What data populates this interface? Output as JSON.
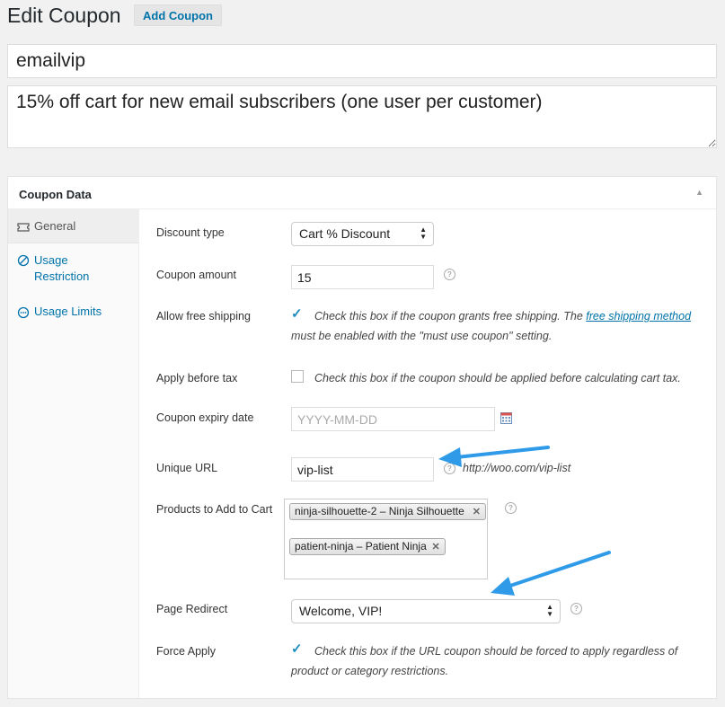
{
  "header": {
    "title": "Edit Coupon",
    "add_button": "Add Coupon"
  },
  "coupon": {
    "code": "emailvip",
    "description": "15% off cart for new email subscribers (one user per customer)"
  },
  "panel": {
    "title": "Coupon Data",
    "tabs": [
      {
        "label": "General",
        "icon": "ticket-icon"
      },
      {
        "label": "Usage Restriction",
        "icon": "ban-icon"
      },
      {
        "label": "Usage Limits",
        "icon": "dots-icon"
      }
    ]
  },
  "fields": {
    "discount_type": {
      "label": "Discount type",
      "value": "Cart % Discount"
    },
    "coupon_amount": {
      "label": "Coupon amount",
      "value": "15"
    },
    "free_shipping": {
      "label": "Allow free shipping",
      "checked": true,
      "desc_before": "Check this box if the coupon grants free shipping. The",
      "link_text": "free shipping method",
      "desc_after": "must be enabled with the \"must use coupon\" setting."
    },
    "apply_before_tax": {
      "label": "Apply before tax",
      "checked": false,
      "desc": "Check this box if the coupon should be applied before calculating cart tax."
    },
    "expiry_date": {
      "label": "Coupon expiry date",
      "placeholder": "YYYY-MM-DD"
    },
    "unique_url": {
      "label": "Unique URL",
      "value": "vip-list",
      "hint": "http://woo.com/vip-list"
    },
    "products_to_add": {
      "label": "Products to Add to Cart",
      "tokens": [
        "ninja-silhouette-2 – Ninja Silhouette",
        "patient-ninja – Patient Ninja"
      ]
    },
    "page_redirect": {
      "label": "Page Redirect",
      "value": "Welcome, VIP!"
    },
    "force_apply": {
      "label": "Force Apply",
      "checked": true,
      "desc": "Check this box if the URL coupon should be forced to apply regardless of product or category restrictions."
    }
  },
  "colors": {
    "accent": "#0073aa",
    "check": "#1e8cbe",
    "annotation_arrow": "#2f9be8"
  }
}
